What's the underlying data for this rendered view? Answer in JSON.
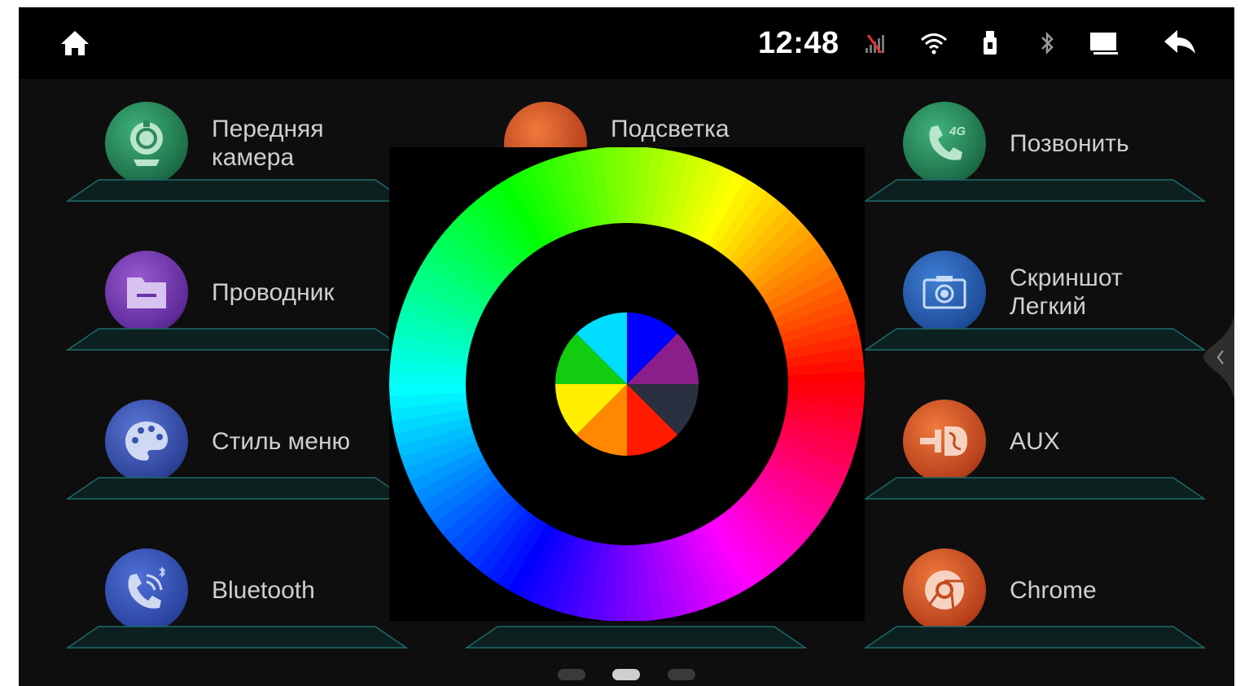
{
  "statusbar": {
    "time": "12:48",
    "icons": [
      "home-icon",
      "no-signal-icon",
      "wifi-icon",
      "usb-icon",
      "bluetooth-icon",
      "screen-icon",
      "back-icon"
    ]
  },
  "apps": [
    {
      "label_line1": "Передняя",
      "label_line2": "камера",
      "icon": "front-camera-icon",
      "color": "#2e8b57"
    },
    {
      "label_line1": "Подсветка",
      "label_line2": "",
      "icon": "backlight-icon",
      "color": "#e05a2a"
    },
    {
      "label_line1": "Позвонить",
      "label_line2": "",
      "icon": "phone-4g-icon",
      "color": "#2e8b57"
    },
    {
      "label_line1": "Проводник",
      "label_line2": "",
      "icon": "folder-icon",
      "color": "#7a3fb0"
    },
    {
      "label_line1": "Скриншот",
      "label_line2": "Легкий",
      "icon": "screenshot-camera-icon",
      "color": "#2a5fb0"
    },
    {
      "label_line1": "Стиль меню",
      "label_line2": "",
      "icon": "palette-icon",
      "color": "#3a55b0"
    },
    {
      "label_line1": "AUX",
      "label_line2": "",
      "icon": "aux-icon",
      "color": "#d0582c"
    },
    {
      "label_line1": "Bluetooth",
      "label_line2": "",
      "icon": "bluetooth-phone-icon",
      "color": "#3355b5"
    },
    {
      "label_line1": "Chrome",
      "label_line2": "",
      "icon": "chrome-icon",
      "color": "#d0582c"
    }
  ],
  "color_picker": {
    "ring": "hue-ring",
    "swatches": [
      "#0000ff",
      "#8b1e8b",
      "#2b3040",
      "#ff1a00",
      "#ff8800",
      "#ffee00",
      "#11cc11",
      "#00ddff"
    ]
  },
  "pager": {
    "pages": 3,
    "active_page": 2
  }
}
